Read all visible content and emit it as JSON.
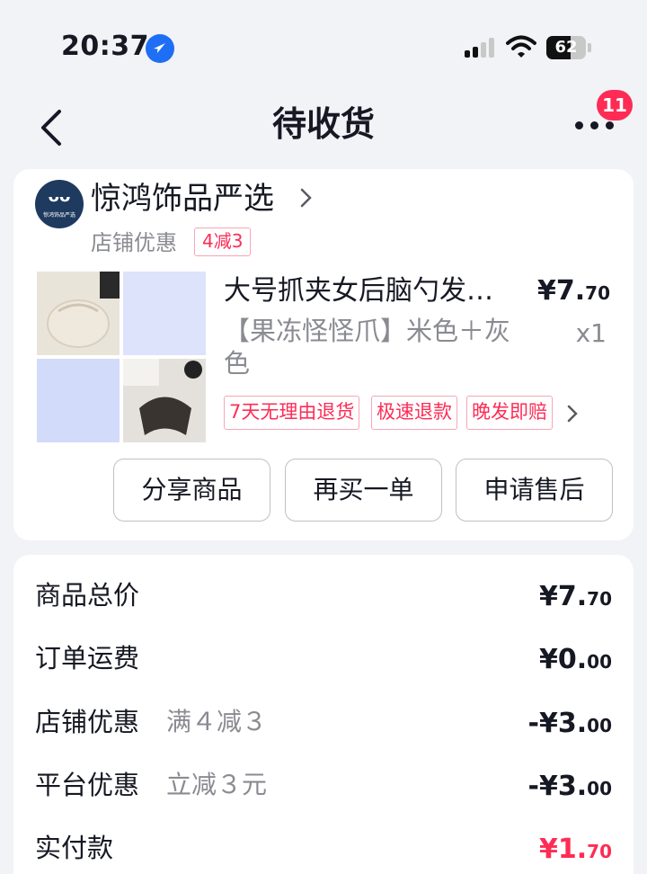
{
  "status_bar": {
    "time": "20:37",
    "battery": "62",
    "battery_level_pct": 62
  },
  "nav": {
    "title": "待收货",
    "more_badge": "11"
  },
  "shop": {
    "name": "惊鸿饰品严选",
    "logo_text": "惊鸿饰品严选",
    "promo_label": "店铺优惠",
    "promo_chip": "4减3"
  },
  "product": {
    "title": "大号抓夹女后脑勺发…",
    "price_main": "¥7.",
    "price_cents": "70",
    "spec": "【果冻怪怪爪】米色＋灰色",
    "qty": "x1",
    "tags": [
      "7天无理由退货",
      "极速退款",
      "晚发即赔"
    ]
  },
  "actions": {
    "share": "分享商品",
    "rebuy": "再买一单",
    "after_sale": "申请售后"
  },
  "summary": [
    {
      "label": "商品总价",
      "detail": "",
      "amount_main": "¥7.",
      "amount_cents": "70"
    },
    {
      "label": "订单运费",
      "detail": "",
      "amount_main": "¥0.",
      "amount_cents": "00"
    },
    {
      "label": "店铺优惠",
      "detail": "满４减３",
      "amount_main": "-¥3.",
      "amount_cents": "00"
    },
    {
      "label": "平台优惠",
      "detail": "立减３元",
      "amount_main": "-¥3.",
      "amount_cents": "00"
    },
    {
      "label": "实付款",
      "detail": "",
      "amount_main": "¥1.",
      "amount_cents": "70"
    }
  ],
  "colors": {
    "accent": "#fe2c55",
    "text": "#161823",
    "muted": "#8a8b91",
    "background": "#f2f3f7"
  }
}
